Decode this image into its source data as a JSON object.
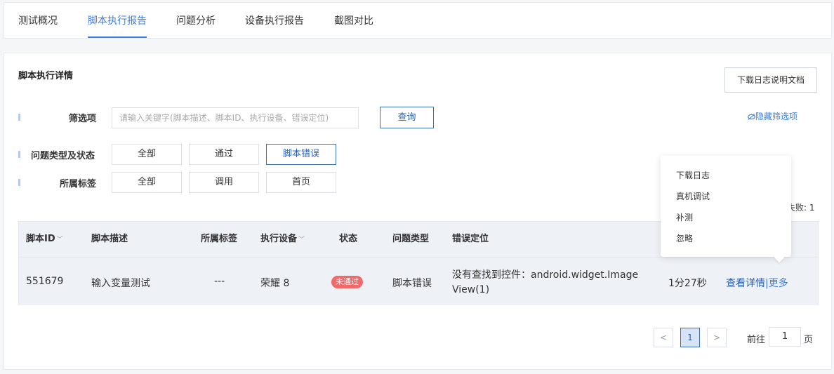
{
  "tabs": [
    {
      "label": "测试概况",
      "active": false
    },
    {
      "label": "脚本执行报告",
      "active": true
    },
    {
      "label": "问题分析",
      "active": false
    },
    {
      "label": "设备执行报告",
      "active": false
    },
    {
      "label": "截图对比",
      "active": false
    }
  ],
  "section": {
    "title": "脚本执行详情",
    "download_doc_label": "下载日志说明文档"
  },
  "filters": {
    "filter_label": "筛选项",
    "search_placeholder": "请输入关键字(脚本描述、脚本ID、执行设备、错误定位)",
    "query_label": "查询",
    "hide_filters_label": "隐藏筛选项",
    "type_status_label": "问题类型及状态",
    "type_status_options": [
      "全部",
      "通过",
      "脚本错误"
    ],
    "type_status_selected": "脚本错误",
    "tag_label": "所属标签",
    "tag_options": [
      "全部",
      "调用",
      "首页"
    ]
  },
  "summary": {
    "fail_text": "失败: 1"
  },
  "table": {
    "headers": {
      "script_id": "脚本ID",
      "script_desc": "脚本描述",
      "tag": "所属标签",
      "device": "执行设备",
      "status": "状态",
      "issue_type": "问题类型",
      "error_location": "错误定位"
    },
    "rows": [
      {
        "script_id": "551679",
        "script_desc": "输入变量测试",
        "tag": "---",
        "device": "荣耀 8",
        "status": "未通过",
        "issue_type": "脚本错误",
        "error_location_line1": "没有查找到控件：android.widget.Image",
        "error_location_line2": "View(1)",
        "duration": "1分27秒",
        "action_details": "查看详情",
        "action_sep": "|",
        "action_more": "更多"
      }
    ]
  },
  "more_menu": {
    "items": [
      "下载日志",
      "真机调试",
      "补测",
      "忽略"
    ]
  },
  "pagination": {
    "prev": "<",
    "current": "1",
    "next": ">",
    "goto_prefix": "前往",
    "goto_value": "1",
    "goto_suffix": "页"
  },
  "colors": {
    "accent": "#3d7ddc",
    "primary_border": "#3d6fb8",
    "fail_badge": "#f06a6a",
    "table_bg": "#eef1f6"
  },
  "icons": {
    "hide_filters": "eye-off-icon",
    "sort": "chevron-down-icon"
  }
}
